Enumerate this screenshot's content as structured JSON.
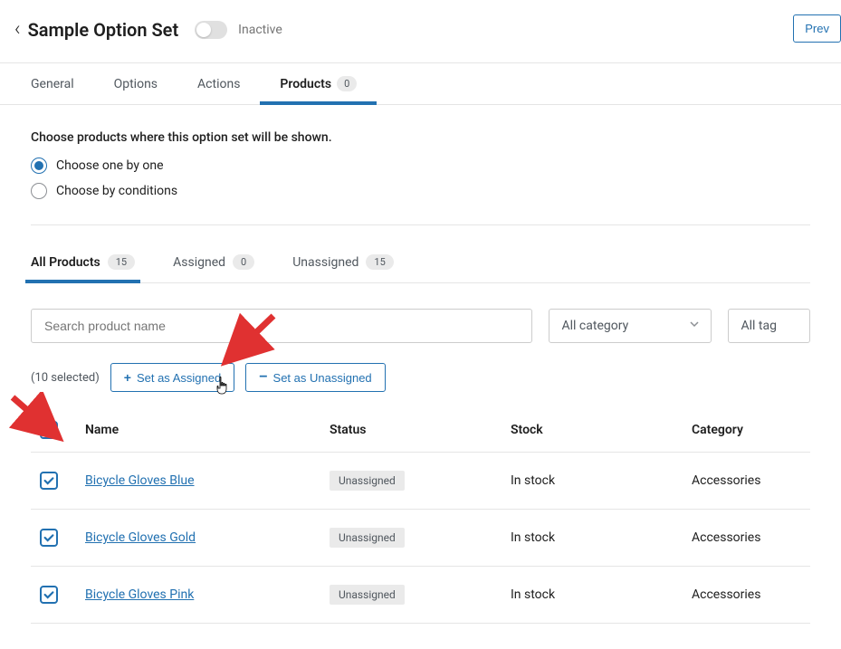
{
  "header": {
    "title": "Sample Option Set",
    "toggle_status": "Inactive",
    "preview_button": "Prev"
  },
  "tabs": [
    {
      "label": "General"
    },
    {
      "label": "Options"
    },
    {
      "label": "Actions"
    },
    {
      "label": "Products",
      "badge": "0",
      "active": true
    }
  ],
  "section": {
    "description": "Choose products where this option set will be shown.",
    "radio_options": [
      {
        "label": "Choose one by one",
        "checked": true
      },
      {
        "label": "Choose by conditions",
        "checked": false
      }
    ]
  },
  "subtabs": [
    {
      "label": "All Products",
      "count": "15",
      "active": true
    },
    {
      "label": "Assigned",
      "count": "0"
    },
    {
      "label": "Unassigned",
      "count": "15"
    }
  ],
  "filters": {
    "search_placeholder": "Search product name",
    "category_select": "All category",
    "tag_select": "All tag"
  },
  "bulk_actions": {
    "selected_text": "(10 selected)",
    "assign_button": "Set as Assigned",
    "unassign_button": "Set as Unassigned"
  },
  "table": {
    "headers": {
      "name": "Name",
      "status": "Status",
      "stock": "Stock",
      "category": "Category"
    },
    "rows": [
      {
        "name": "Bicycle Gloves Blue",
        "status": "Unassigned",
        "stock": "In stock",
        "category": "Accessories"
      },
      {
        "name": "Bicycle Gloves Gold",
        "status": "Unassigned",
        "stock": "In stock",
        "category": "Accessories"
      },
      {
        "name": "Bicycle Gloves Pink",
        "status": "Unassigned",
        "stock": "In stock",
        "category": "Accessories"
      }
    ]
  }
}
